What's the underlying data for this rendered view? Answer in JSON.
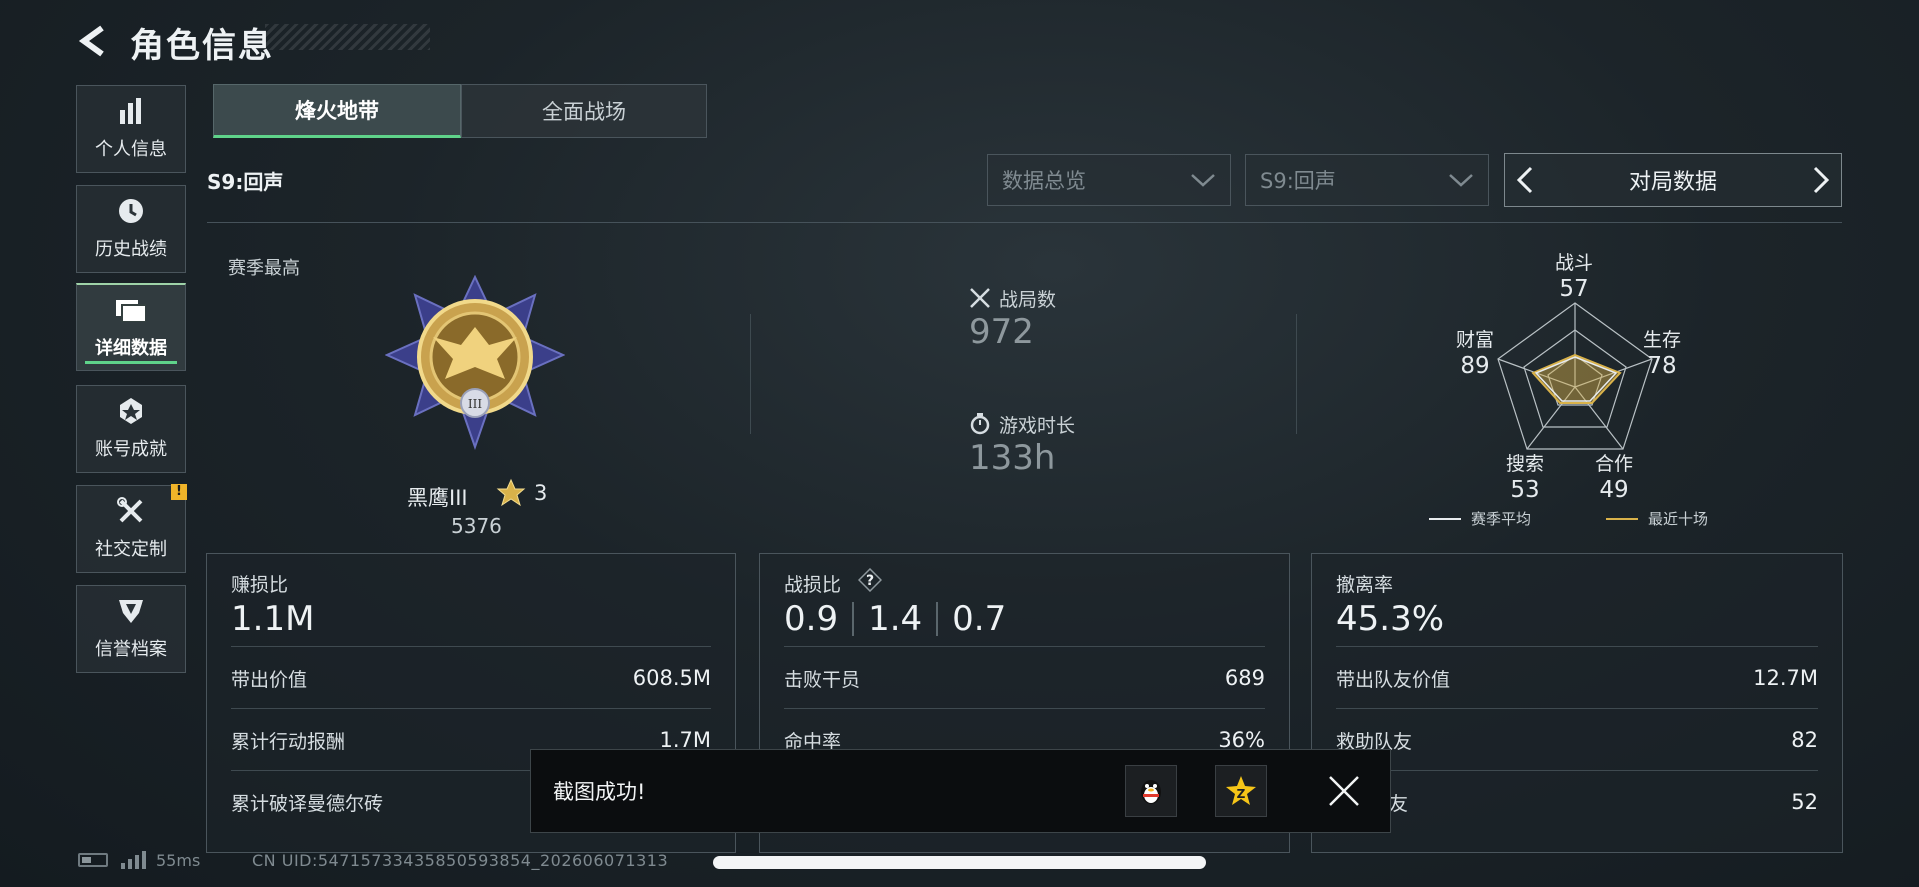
{
  "header": {
    "title": "角色信息"
  },
  "sidebar": {
    "items": [
      {
        "label": "个人信息",
        "icon": "bar-chart-icon"
      },
      {
        "label": "历史战绩",
        "icon": "clock-icon"
      },
      {
        "label": "详细数据",
        "icon": "folder-icon",
        "active": true
      },
      {
        "label": "账号成就",
        "icon": "medal-icon"
      },
      {
        "label": "社交定制",
        "icon": "tools-icon",
        "badge": "!"
      },
      {
        "label": "信誉档案",
        "icon": "shield-icon"
      }
    ]
  },
  "tabs": [
    {
      "label": "烽火地带",
      "active": true
    },
    {
      "label": "全面战场",
      "active": false
    }
  ],
  "season_label": "S9:回声",
  "filters": {
    "data_type": "数据总览",
    "season": "S9:回声",
    "match_nav_label": "对局数据"
  },
  "overview": {
    "season_best_label": "赛季最高",
    "rank_name": "黑鹰III",
    "rank_stars": "3",
    "rank_score": "5376",
    "matches_label": "战局数",
    "matches_value": "972",
    "playtime_label": "游戏时长",
    "playtime_value": "133h"
  },
  "radar": {
    "axes": [
      {
        "label": "战斗",
        "value": "57"
      },
      {
        "label": "生存",
        "value": "78"
      },
      {
        "label": "合作",
        "value": "49"
      },
      {
        "label": "搜索",
        "value": "53"
      },
      {
        "label": "财富",
        "value": "89"
      }
    ],
    "legend": [
      {
        "label": "赛季平均",
        "color": "#e8ecef"
      },
      {
        "label": "最近十场",
        "color": "#d9b24a"
      }
    ]
  },
  "panels": [
    {
      "title": "赚损比",
      "value": "1.1M",
      "rows": [
        {
          "label": "带出价值",
          "value": "608.5M"
        },
        {
          "label": "累计行动报酬",
          "value": "1.7M"
        },
        {
          "label": "累计破译曼德尔砖",
          "value": ""
        }
      ]
    },
    {
      "title": "战损比",
      "values": [
        "0.9",
        "1.4",
        "0.7"
      ],
      "rows": [
        {
          "label": "击败干员",
          "value": "689"
        },
        {
          "label": "命中率",
          "value": "36%"
        }
      ]
    },
    {
      "title": "撤离率",
      "value": "45.3%",
      "rows": [
        {
          "label": "带出队友价值",
          "value": "12.7M"
        },
        {
          "label": "救助队友",
          "value": "82"
        },
        {
          "label": "队友",
          "value": "52"
        }
      ]
    }
  ],
  "toast": {
    "text": "截图成功!"
  },
  "status": {
    "ping": "55ms",
    "uid": "CN UID:547157334358505938​54_202606071313"
  },
  "colors": {
    "accent_green": "#5fd38a",
    "gold": "#d9b24a",
    "warning": "#f0b429"
  }
}
